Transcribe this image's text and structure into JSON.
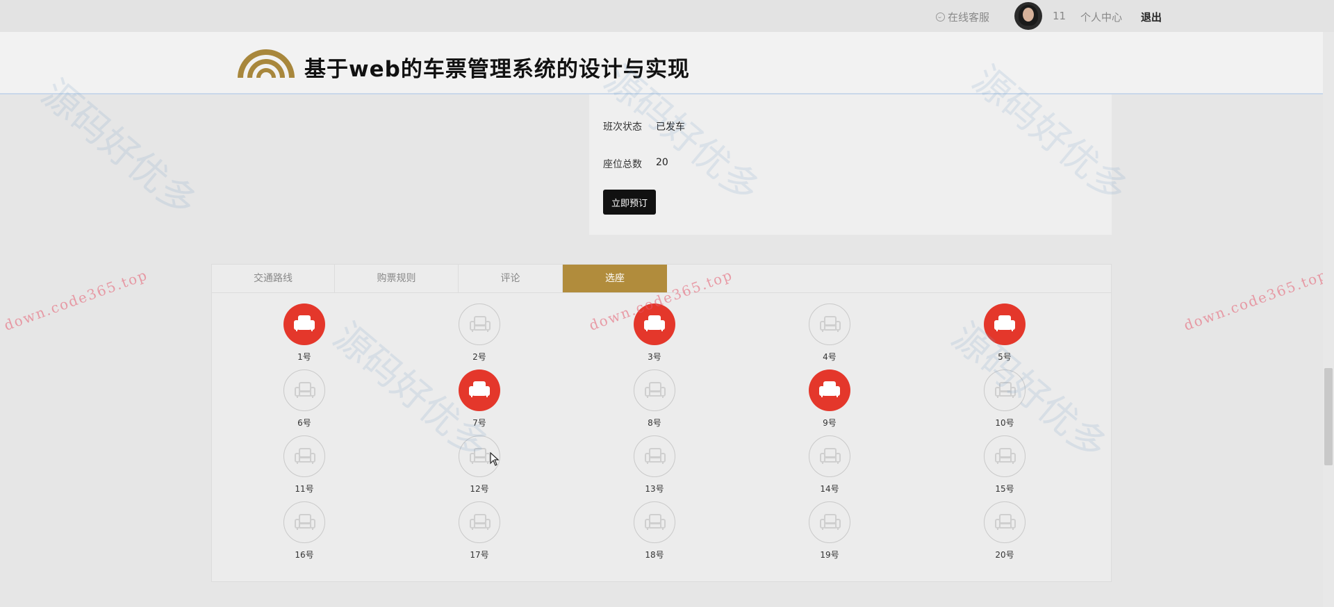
{
  "topbar": {
    "service_label": "在线客服",
    "username": "11",
    "profile_label": "个人中心",
    "logout_label": "退出"
  },
  "header": {
    "title": "基于web的车票管理系统的设计与实现"
  },
  "info": {
    "status_label": "班次状态",
    "status_value": "已发车",
    "seats_label": "座位总数",
    "seats_value": "20",
    "book_label": "立即预订"
  },
  "tabs": [
    {
      "label": "交通路线"
    },
    {
      "label": "购票规则"
    },
    {
      "label": "评论"
    },
    {
      "label": "选座"
    }
  ],
  "seats": [
    {
      "label": "1号",
      "taken": true
    },
    {
      "label": "2号",
      "taken": false
    },
    {
      "label": "3号",
      "taken": true
    },
    {
      "label": "4号",
      "taken": false
    },
    {
      "label": "5号",
      "taken": true
    },
    {
      "label": "6号",
      "taken": false
    },
    {
      "label": "7号",
      "taken": true
    },
    {
      "label": "8号",
      "taken": false
    },
    {
      "label": "9号",
      "taken": true
    },
    {
      "label": "10号",
      "taken": false
    },
    {
      "label": "11号",
      "taken": false
    },
    {
      "label": "12号",
      "taken": false
    },
    {
      "label": "13号",
      "taken": false
    },
    {
      "label": "14号",
      "taken": false
    },
    {
      "label": "15号",
      "taken": false
    },
    {
      "label": "16号",
      "taken": false
    },
    {
      "label": "17号",
      "taken": false
    },
    {
      "label": "18号",
      "taken": false
    },
    {
      "label": "19号",
      "taken": false
    },
    {
      "label": "20号",
      "taken": false
    }
  ],
  "watermark": {
    "url_text": "down.code365.top",
    "cn_text": "源码好优多"
  },
  "colors": {
    "accent": "#b18c3c",
    "taken_seat": "#e4372b",
    "free_seat_border": "#c9c9c9"
  }
}
